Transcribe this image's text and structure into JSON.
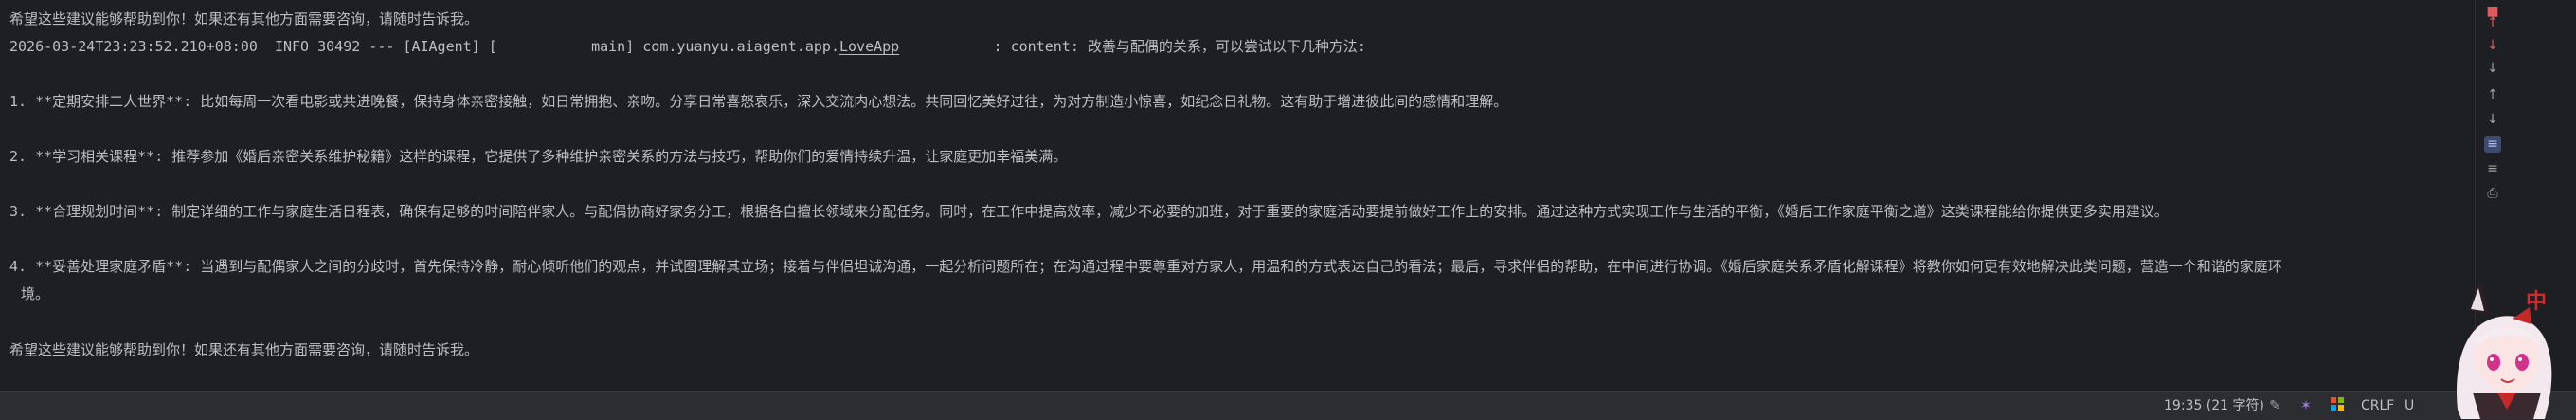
{
  "console": {
    "line1": "希望这些建议能够帮助到你！如果还有其他方面需要咨询，请随时告诉我。",
    "log_prefix": "2026-03-24T23:23:52.210+08:00  INFO 30492 --- [AIAgent] [           main] com.yuanyu.aiagent.app.",
    "log_class": "LoveApp",
    "log_suffix": "           : content: 改善与配偶的关系，可以尝试以下几种方法:",
    "item1": "1. **定期安排二人世界**: 比如每周一次看电影或共进晚餐，保持身体亲密接触，如日常拥抱、亲吻。分享日常喜怒哀乐，深入交流内心想法。共同回忆美好过往，为对方制造小惊喜，如纪念日礼物。这有助于增进彼此间的感情和理解。",
    "item2": "2. **学习相关课程**: 推荐参加《婚后亲密关系维护秘籍》这样的课程，它提供了多种维护亲密关系的方法与技巧，帮助你们的爱情持续升温，让家庭更加幸福美满。",
    "item3": "3. **合理规划时间**: 制定详细的工作与家庭生活日程表，确保有足够的时间陪伴家人。与配偶协商好家务分工，根据各自擅长领域来分配任务。同时，在工作中提高效率，减少不必要的加班，对于重要的家庭活动要提前做好工作上的安排。通过这种方式实现工作与生活的平衡，《婚后工作家庭平衡之道》这类课程能给你提供更多实用建议。",
    "item4": "4. **妥善处理家庭矛盾**: 当遇到与配偶家人之间的分歧时，首先保持冷静，耐心倾听他们的观点，并试图理解其立场；接着与伴侣坦诚沟通，一起分析问题所在；在沟通过程中要尊重对方家人，用温和的方式表达自己的看法；最后，寻求伴侣的帮助，在中间进行协调。《婚后家庭关系矛盾化解课程》将教你如何更有效地解决此类问题，营造一个和谐的家庭环",
    "item4_cont": "境。",
    "closing": "希望这些建议能够帮助到你！如果还有其他方面需要咨询，请随时告诉我。"
  },
  "gutter": {
    "icons": [
      "stop-icon",
      "scroll-up-icon",
      "scroll-down-icon",
      "sort-icon",
      "up-icon",
      "down-icon",
      "soft-wrap-icon",
      "filter-icon",
      "print-icon"
    ],
    "colors": {
      "red": "#e0595e",
      "active_bg": "#3d4b6e"
    }
  },
  "status": {
    "position": "19:35 (21 字符)",
    "line_ending": "CRLF",
    "encoding": "U"
  },
  "mascot": {
    "badge": "中"
  }
}
